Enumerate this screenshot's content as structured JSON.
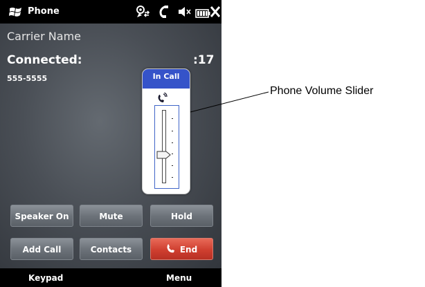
{
  "status_bar": {
    "title": "Phone",
    "icons": [
      "windows-flag-icon",
      "signal-sync-icon",
      "call-active-icon",
      "speaker-muted-icon",
      "battery-icon",
      "close-icon"
    ]
  },
  "call": {
    "carrier": "Carrier Name",
    "status": "Connected:",
    "timer_visible": ":17",
    "number": "555-5555"
  },
  "volume_popup": {
    "header": "In Call",
    "icon": "phone-ringing-icon",
    "level_fraction": 0.4
  },
  "buttons": [
    {
      "label": "Speaker On"
    },
    {
      "label": "Mute"
    },
    {
      "label": "Hold"
    },
    {
      "label": "Add Call"
    },
    {
      "label": "Contacts"
    },
    {
      "label": "End"
    }
  ],
  "softkeys": {
    "left": "Keypad",
    "right": "Menu"
  },
  "callout": {
    "label": "Phone Volume Slider"
  },
  "colors": {
    "popup_header": "#3553c9",
    "end_button": "#cf3f30",
    "button_gray": "#6d737a"
  }
}
